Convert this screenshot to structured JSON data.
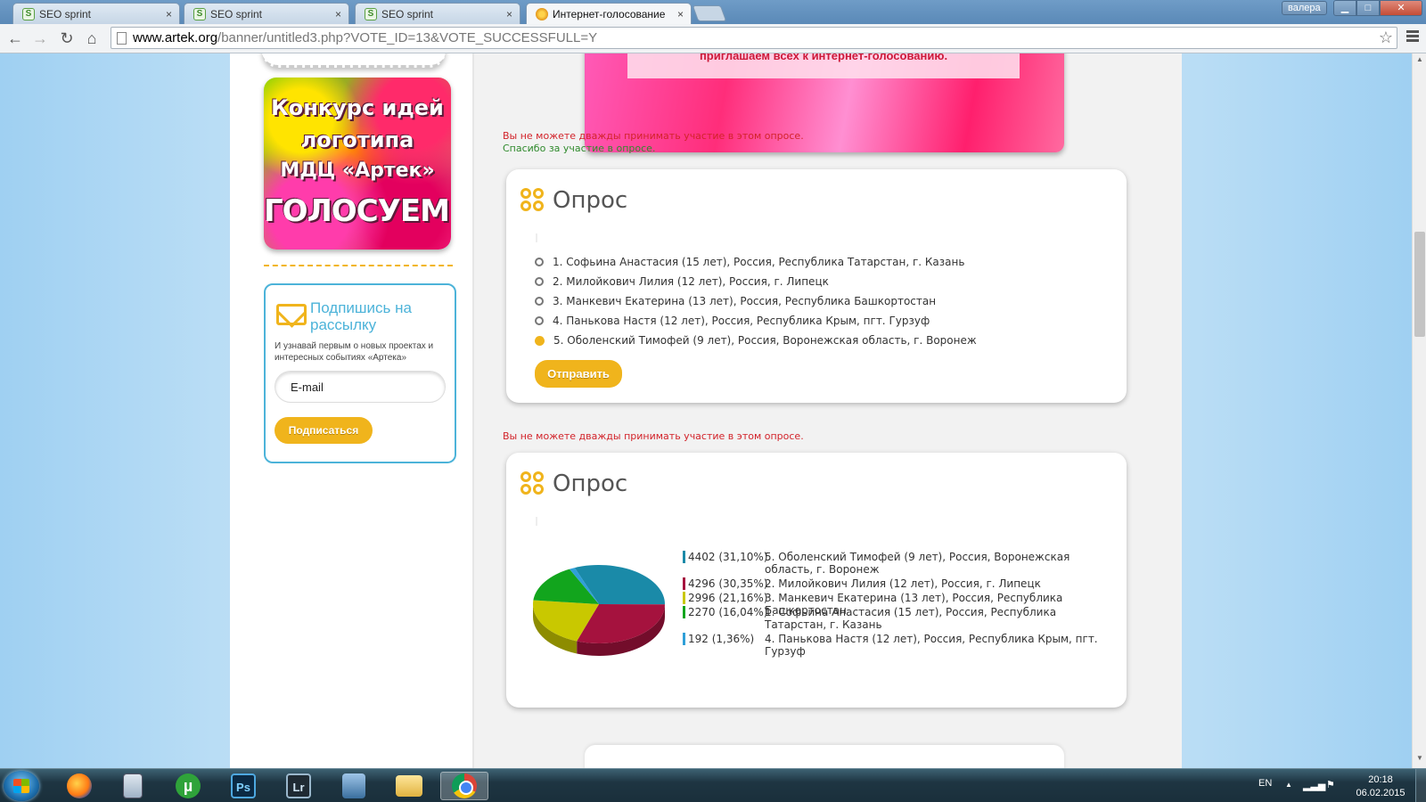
{
  "browser": {
    "tabs": [
      {
        "title": "SEO sprint",
        "icon": "seo-sprint-favicon",
        "close": "×"
      },
      {
        "title": "SEO sprint",
        "icon": "seo-sprint-favicon",
        "close": "×"
      },
      {
        "title": "SEO sprint",
        "icon": "seo-sprint-favicon",
        "close": "×"
      },
      {
        "title": "Интернет-голосование",
        "icon": "artek-favicon",
        "close": "×"
      }
    ],
    "user_badge": "валера",
    "window_buttons": {
      "minimize": "▁",
      "maximize": "□",
      "close": "✕"
    },
    "nav": {
      "back": "←",
      "forward": "→",
      "reload": "↻",
      "home": "⌂"
    },
    "url_host": "www.artek.org",
    "url_path": "/banner/untitled3.php?VOTE_ID=13&VOTE_SUCCESSFULL=Y",
    "star": "☆"
  },
  "sidebar": {
    "promo": {
      "line1": "Конкурс идей",
      "line2": "логотипа",
      "line3": "МДЦ «Артек»",
      "line4": "ГОЛОСУЕМ!"
    },
    "subscribe": {
      "title": "Подпишись на рассылку",
      "text": "И узнавай первым о новых проектах и интересных событиях «Артека»",
      "email_placeholder": "E-mail",
      "button": "Подписаться"
    }
  },
  "banner": {
    "text": "приглашаем всех к интернет-голосованию."
  },
  "messages": {
    "already_voted": "Вы не можете дважды принимать участие в этом опросе.",
    "thanks": "Спасибо за участие в опросе."
  },
  "poll_form": {
    "title": "Опрос",
    "options": [
      {
        "label": "1. Софьина Анастасия (15 лет), Россия, Республика Татарстан, г. Казань",
        "selected": false
      },
      {
        "label": "2. Милойкович Лилия (12 лет), Россия, г. Липецк",
        "selected": false
      },
      {
        "label": "3. Манкевич Екатерина (13 лет), Россия, Республика Башкортостан",
        "selected": false
      },
      {
        "label": "4. Панькова Настя (12 лет), Россия, Республика Крым, пгт. Гурзуф",
        "selected": false
      },
      {
        "label": "5. Оболенский Тимофей (9 лет), Россия, Воронежская область, г. Воронеж",
        "selected": true
      }
    ],
    "submit": "Отправить"
  },
  "poll_results": {
    "title": "Опрос",
    "message": "Вы не можете дважды принимать участие в этом опросе."
  },
  "chart_data": {
    "type": "pie",
    "title": "",
    "series": [
      {
        "value_text": "4402 (31,10%)",
        "label": "5. Оболенский Тимофей (9 лет), Россия, Воронежская область, г. Воронеж",
        "value": 4402,
        "percent": 31.1,
        "color": "#1a8aa8"
      },
      {
        "value_text": "4296 (30,35%)",
        "label": "2. Милойкович Лилия (12 лет), Россия, г. Липецк",
        "value": 4296,
        "percent": 30.35,
        "color": "#a5123e"
      },
      {
        "value_text": "2996 (21,16%)",
        "label": "3. Манкевич Екатерина (13 лет), Россия, Республика Башкортостан",
        "value": 2996,
        "percent": 21.16,
        "color": "#c9c800"
      },
      {
        "value_text": "2270 (16,04%)",
        "label": "1. Софьина Анастасия (15 лет), Россия, Республика Татарстан, г. Казань",
        "value": 2270,
        "percent": 16.04,
        "color": "#12a51d"
      },
      {
        "value_text": "192 (1,36%)",
        "label": "4. Панькова Настя (12 лет), Россия, Республика Крым, пгт. Гурзуф",
        "value": 192,
        "percent": 1.36,
        "color": "#2f9fd8"
      }
    ]
  },
  "taskbar": {
    "apps": [
      {
        "name": "firefox",
        "label": ""
      },
      {
        "name": "calculator",
        "label": ""
      },
      {
        "name": "utorrent",
        "label": "µ"
      },
      {
        "name": "photoshop",
        "label": "Ps"
      },
      {
        "name": "lightroom",
        "label": "Lr"
      },
      {
        "name": "network",
        "label": ""
      },
      {
        "name": "explorer",
        "label": ""
      },
      {
        "name": "chrome",
        "label": ""
      }
    ],
    "lang": "EN",
    "tray_arrow": "▲",
    "time": "20:18",
    "date": "06.02.2015"
  }
}
